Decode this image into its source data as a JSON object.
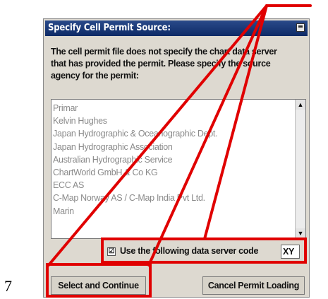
{
  "page_number": "7",
  "dialog": {
    "title": "Specify Cell Permit Source:",
    "description_lines": [
      "The cell permit file does not specify the chart data server",
      "that has provided the permit. Please specify the source",
      " agency for the permit:"
    ],
    "agencies": [
      "Primar",
      "Kelvin Hughes",
      "Japan Hydrographic & Oceanographic Dept.",
      "Japan Hydrographic Association",
      "Australian Hydrographic Service",
      "ChartWorld GmbH & Co KG",
      "ECC AS",
      "C-Map Norway AS / C-Map India Pvt Ltd.",
      "Marin"
    ],
    "checkbox_label": "Use the following data server code",
    "checkbox_checked": true,
    "checkbox_mark": "☑",
    "server_code": "XY",
    "select_button": "Select and Continue",
    "cancel_button": "Cancel Permit Loading"
  },
  "colors": {
    "annotation": "#e00000",
    "titlebar": "#1a3a7a"
  }
}
